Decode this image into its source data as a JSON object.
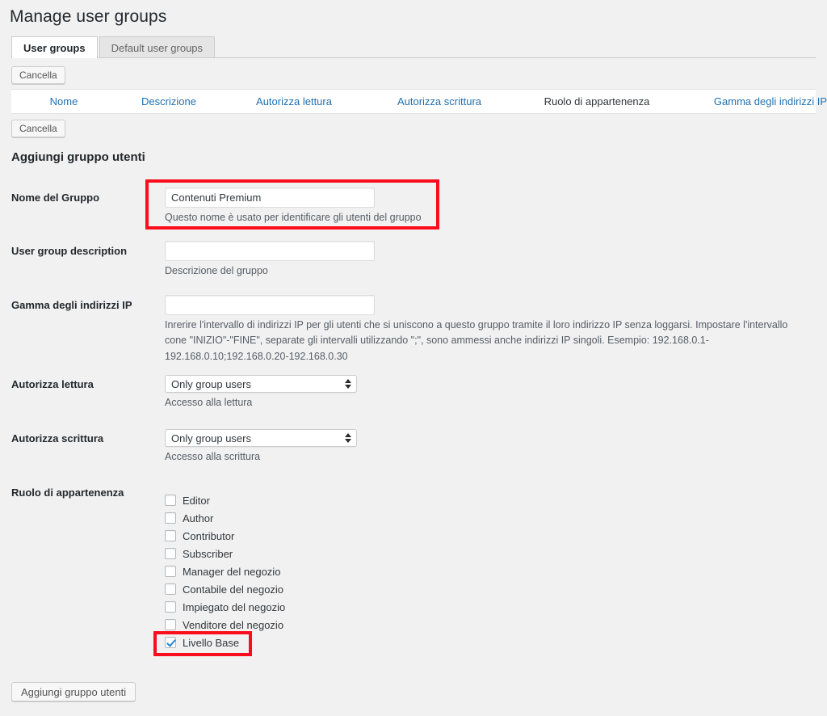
{
  "page": {
    "title": "Manage user groups"
  },
  "tabs": [
    {
      "label": "User groups",
      "active": true
    },
    {
      "label": "Default user groups",
      "active": false
    }
  ],
  "actions": {
    "delete_top": "Cancella",
    "delete_bottom": "Cancella",
    "submit": "Aggiungi gruppo utenti"
  },
  "list_table": {
    "columns": [
      {
        "label": "Nome",
        "link": true
      },
      {
        "label": "Descrizione",
        "link": true
      },
      {
        "label": "Autorizza lettura",
        "link": true
      },
      {
        "label": "Autorizza scrittura",
        "link": true
      },
      {
        "label": "Ruolo di appartenenza",
        "link": false
      },
      {
        "label": "Gamma degli indirizzi IP",
        "link": true
      }
    ],
    "rows": []
  },
  "form": {
    "heading": "Aggiungi gruppo utenti",
    "group_name": {
      "label": "Nome del Gruppo",
      "value": "Contenuti Premium",
      "placeholder": "",
      "hint": "Questo nome è usato per identificare gli utenti del gruppo"
    },
    "group_description": {
      "label": "User group description",
      "value": "",
      "placeholder": "",
      "hint": "Descrizione del gruppo"
    },
    "ip_range": {
      "label": "Gamma degli indirizzi IP",
      "value": "",
      "placeholder": "",
      "hint": "Inrerire l'intervallo di indirizzi IP per gli utenti che si uniscono a questo gruppo tramite il loro indirizzo IP senza loggarsi. Impostare l'intervallo cone \"INIZIO\"-\"FINE\", separate gli intervalli utilizzando \";\", sono ammessi anche indirizzi IP singoli. Esempio: 192.168.0.1-192.168.0.10;192.168.0.20-192.168.0.30"
    },
    "read_permission": {
      "label": "Autorizza lettura",
      "value": "Only group users",
      "hint": "Accesso alla lettura"
    },
    "write_permission": {
      "label": "Autorizza scrittura",
      "value": "Only group users",
      "hint": "Accesso alla scrittura"
    },
    "roles": {
      "label": "Ruolo di appartenenza",
      "items": [
        {
          "label": "Editor",
          "checked": false
        },
        {
          "label": "Author",
          "checked": false
        },
        {
          "label": "Contributor",
          "checked": false
        },
        {
          "label": "Subscriber",
          "checked": false
        },
        {
          "label": "Manager del negozio",
          "checked": false
        },
        {
          "label": "Contabile del negozio",
          "checked": false
        },
        {
          "label": "Impiegato del negozio",
          "checked": false
        },
        {
          "label": "Venditore del negozio",
          "checked": false
        },
        {
          "label": "Livello Base",
          "checked": true
        }
      ]
    }
  },
  "annotations": {
    "accent_color": "#fc0d1b",
    "link_color": "#2271b1",
    "checkbox_check_color": "#1e87d6"
  }
}
